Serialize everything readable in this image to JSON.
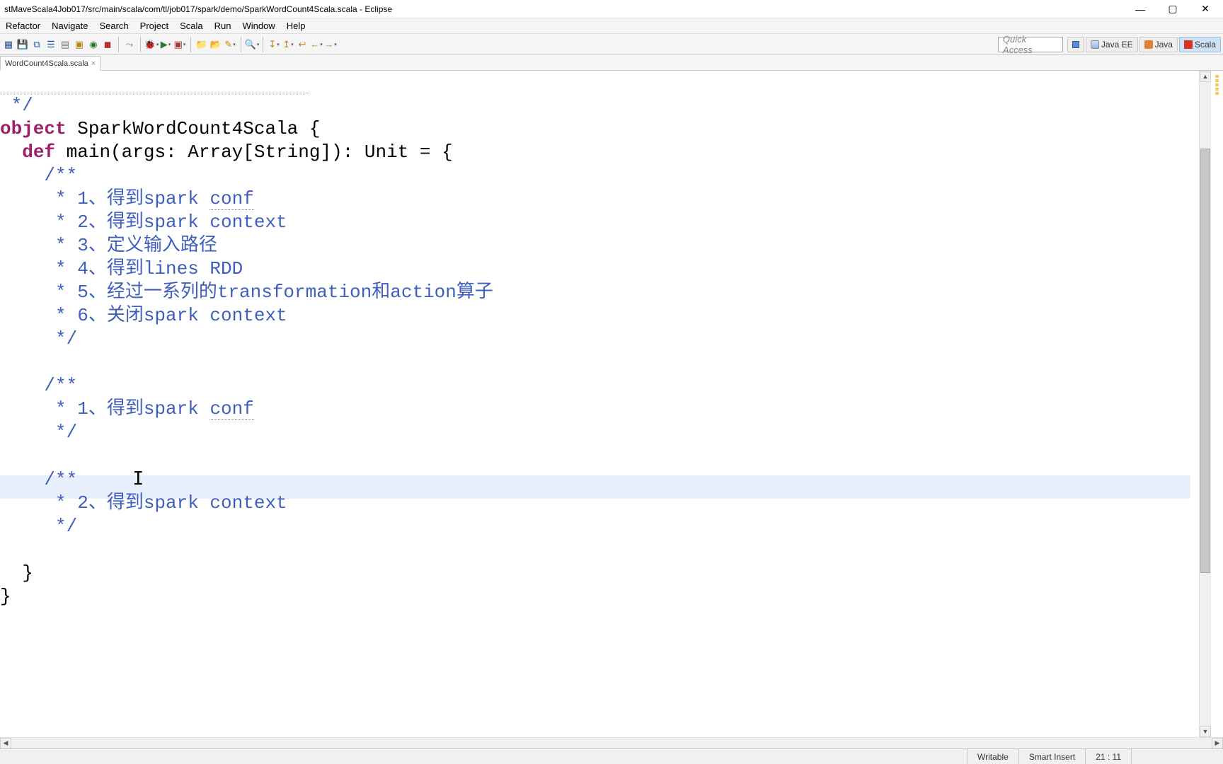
{
  "window": {
    "title": "stMaveScala4Job017/src/main/scala/com/tl/job017/spark/demo/SparkWordCount4Scala.scala - Eclipse"
  },
  "menu": {
    "items": [
      "Refactor",
      "Navigate",
      "Search",
      "Project",
      "Scala",
      "Run",
      "Window",
      "Help"
    ]
  },
  "toolbar": {
    "quick_access_placeholder": "Quick Access",
    "perspectives": [
      {
        "label": "",
        "icon": "open-perspective"
      },
      {
        "label": "Java EE",
        "icon": "javaee"
      },
      {
        "label": "Java",
        "icon": "java"
      },
      {
        "label": "Scala",
        "icon": "scala",
        "active": true
      }
    ]
  },
  "tabs": {
    "active": {
      "label": "WordCount4Scala.scala"
    }
  },
  "code": {
    "lines": [
      {
        "t": "cmt",
        "text": " */"
      },
      {
        "t": "obj",
        "parts": [
          "object",
          " SparkWordCount4Scala {"
        ]
      },
      {
        "t": "def",
        "parts": [
          "  ",
          "def",
          " main(args: Array[String]): Unit = {"
        ]
      },
      {
        "t": "cmt",
        "text": "    /**"
      },
      {
        "t": "cmt-u",
        "text": "     * 1、得到spark ",
        "u": "conf"
      },
      {
        "t": "cmt",
        "text": "     * 2、得到spark context"
      },
      {
        "t": "cmt",
        "text": "     * 3、定义输入路径"
      },
      {
        "t": "cmt",
        "text": "     * 4、得到lines RDD"
      },
      {
        "t": "cmt",
        "text": "     * 5、经过一系列的transformation和action算子"
      },
      {
        "t": "cmt",
        "text": "     * 6、关闭spark context"
      },
      {
        "t": "cmt",
        "text": "     */"
      },
      {
        "t": "blank",
        "text": ""
      },
      {
        "t": "cmt",
        "text": "    /**"
      },
      {
        "t": "cmt-u",
        "text": "     * 1、得到spark ",
        "u": "conf"
      },
      {
        "t": "cmt",
        "text": "     */"
      },
      {
        "t": "blank",
        "text": ""
      },
      {
        "t": "cmt-caret",
        "text": "    /**",
        "caret": "     I"
      },
      {
        "t": "cmt-hl",
        "text": "     * 2、得到spark context"
      },
      {
        "t": "cmt",
        "text": "     */"
      },
      {
        "t": "blank",
        "text": ""
      },
      {
        "t": "plain",
        "text": "  }"
      },
      {
        "t": "plain",
        "text": "}"
      }
    ]
  },
  "status": {
    "writable": "Writable",
    "insert": "Smart Insert",
    "position": "21 : 11"
  }
}
